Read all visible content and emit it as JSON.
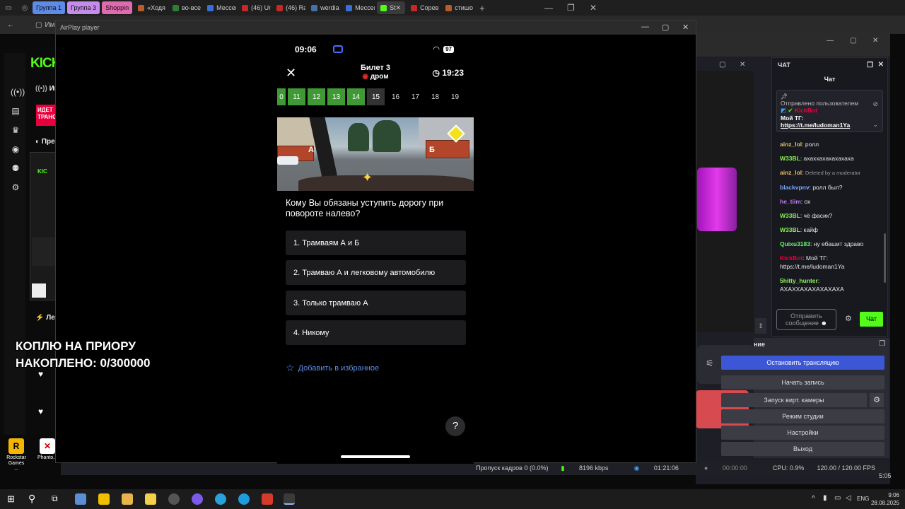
{
  "browser": {
    "tabs": [
      {
        "label": "Группа 1",
        "color": "#5e8ae8",
        "group": true
      },
      {
        "label": "Группа 3",
        "color": "#c58cec",
        "group": true
      },
      {
        "label": "Shoppin",
        "color": "#e06ab0",
        "group": true
      },
      {
        "label": "«Ходя",
        "color": "",
        "group": false
      },
      {
        "label": "во-все",
        "color": "",
        "group": false
      },
      {
        "label": "Мессен",
        "color": "",
        "group": false
      },
      {
        "label": "(46) Un",
        "color": "",
        "group": false
      },
      {
        "label": "(46) Ra",
        "color": "",
        "group": false
      },
      {
        "label": "werdia",
        "color": "",
        "group": false
      },
      {
        "label": "Мессен",
        "color": "",
        "group": false
      },
      {
        "label": "St",
        "color": "",
        "group": false
      },
      {
        "label": "Сорев",
        "color": "",
        "group": false
      },
      {
        "label": "стишо",
        "color": "",
        "group": false
      }
    ],
    "bookmark": "Импорт"
  },
  "kick": {
    "logo": "KICK",
    "live_badge": "ИДЕТ ТРАНС",
    "section_1": "Ино",
    "section_2": "Пре",
    "section_3": "Лен"
  },
  "overlay": {
    "line1": "КОПЛЮ НА ПРИОРУ",
    "line2": "НАКОПЛЕНО: 0/300000"
  },
  "airplay": {
    "title": "AirPlay player",
    "status_time": "09:06",
    "battery": "97",
    "ticket": "Билет 3",
    "brand": "дром",
    "timer": "19:23",
    "questions": [
      {
        "n": "0",
        "state": "ok"
      },
      {
        "n": "11",
        "state": "ok"
      },
      {
        "n": "12",
        "state": "ok"
      },
      {
        "n": "13",
        "state": "ok"
      },
      {
        "n": "14",
        "state": "ok"
      },
      {
        "n": "15",
        "state": "cur"
      },
      {
        "n": "16",
        "state": "idle"
      },
      {
        "n": "17",
        "state": "idle"
      },
      {
        "n": "18",
        "state": "idle"
      },
      {
        "n": "19",
        "state": "idle"
      }
    ],
    "scene_label_a": "А",
    "scene_label_b": "Б",
    "question": "Кому Вы обязаны уступить дорогу при повороте налево?",
    "answers": [
      "1.  Трамваям А и Б",
      "2.  Трамваю А и легковому автомобилю",
      "3.  Только трамваю А",
      "4.  Никому"
    ],
    "favorite": "Добавить в избранное",
    "help": "?"
  },
  "chat": {
    "panel_title": "ЧАТ",
    "subtitle": "Чат",
    "pinned_by": "Отправлено пользователем",
    "pinned_user": "KickBot",
    "pinned_text": "Мой ТГ:",
    "pinned_link": "https://t.me/ludoman1Ya",
    "messages": [
      {
        "user": "ainz_lol",
        "color": "#e8c169",
        "text": "ролл"
      },
      {
        "user": "W33BL",
        "color": "#8bf15b",
        "text": "ахаххахахахахаха"
      },
      {
        "user": "ainz_lol",
        "color": "#e8c169",
        "text": "Deleted by a moderator"
      },
      {
        "user": "blackvpnv",
        "color": "#7aa8ff",
        "text": "ролл был?"
      },
      {
        "user": "he_tiim",
        "color": "#c07af5",
        "text": "ох"
      },
      {
        "user": "W33BL",
        "color": "#8bf15b",
        "text": "чё фасик?"
      },
      {
        "user": "W33BL",
        "color": "#8bf15b",
        "text": "кайф"
      },
      {
        "user": "Quixu3183",
        "color": "#6ef56e",
        "text": "ну ебашит здраво"
      },
      {
        "user": "KickBot",
        "color": "#e8003d",
        "text": "Мой ТГ: https://t.me/ludoman1Ya"
      },
      {
        "user": "5hitty_hunter",
        "color": "#8bf15b",
        "text": "АХАХХАХАХАХАХАХА"
      }
    ],
    "input_placeholder": "Отправить сообщение",
    "send_label": "Чат"
  },
  "obs": {
    "section": "ние",
    "stop_stream": "Остановить трансляцию",
    "start_record": "Начать запись",
    "virtual_cam": "Запуск вирт. камеры",
    "studio_mode": "Режим студии",
    "settings": "Настройки",
    "exit": "Выход",
    "dropped_frames": "Пропуск кадров 0 (0.0%)",
    "bitrate": "8196 kbps",
    "stream_time": "01:21:06",
    "rec_time": "00:00:00",
    "cpu": "CPU: 0.9%",
    "fps": "120.00 / 120.00 FPS",
    "clock_small": "5:05"
  },
  "desktop": {
    "icon1": "Rockstar Games ...",
    "icon2": "Phanto..."
  },
  "taskbar": {
    "lang": "ENG",
    "time": "9:06",
    "date": "28.08.2025"
  },
  "colors": {
    "kick_green": "#53fc18",
    "answer_bg": "#1c1c1e",
    "correct_green": "#3f9a35",
    "obs_blue": "#3c57d6"
  }
}
